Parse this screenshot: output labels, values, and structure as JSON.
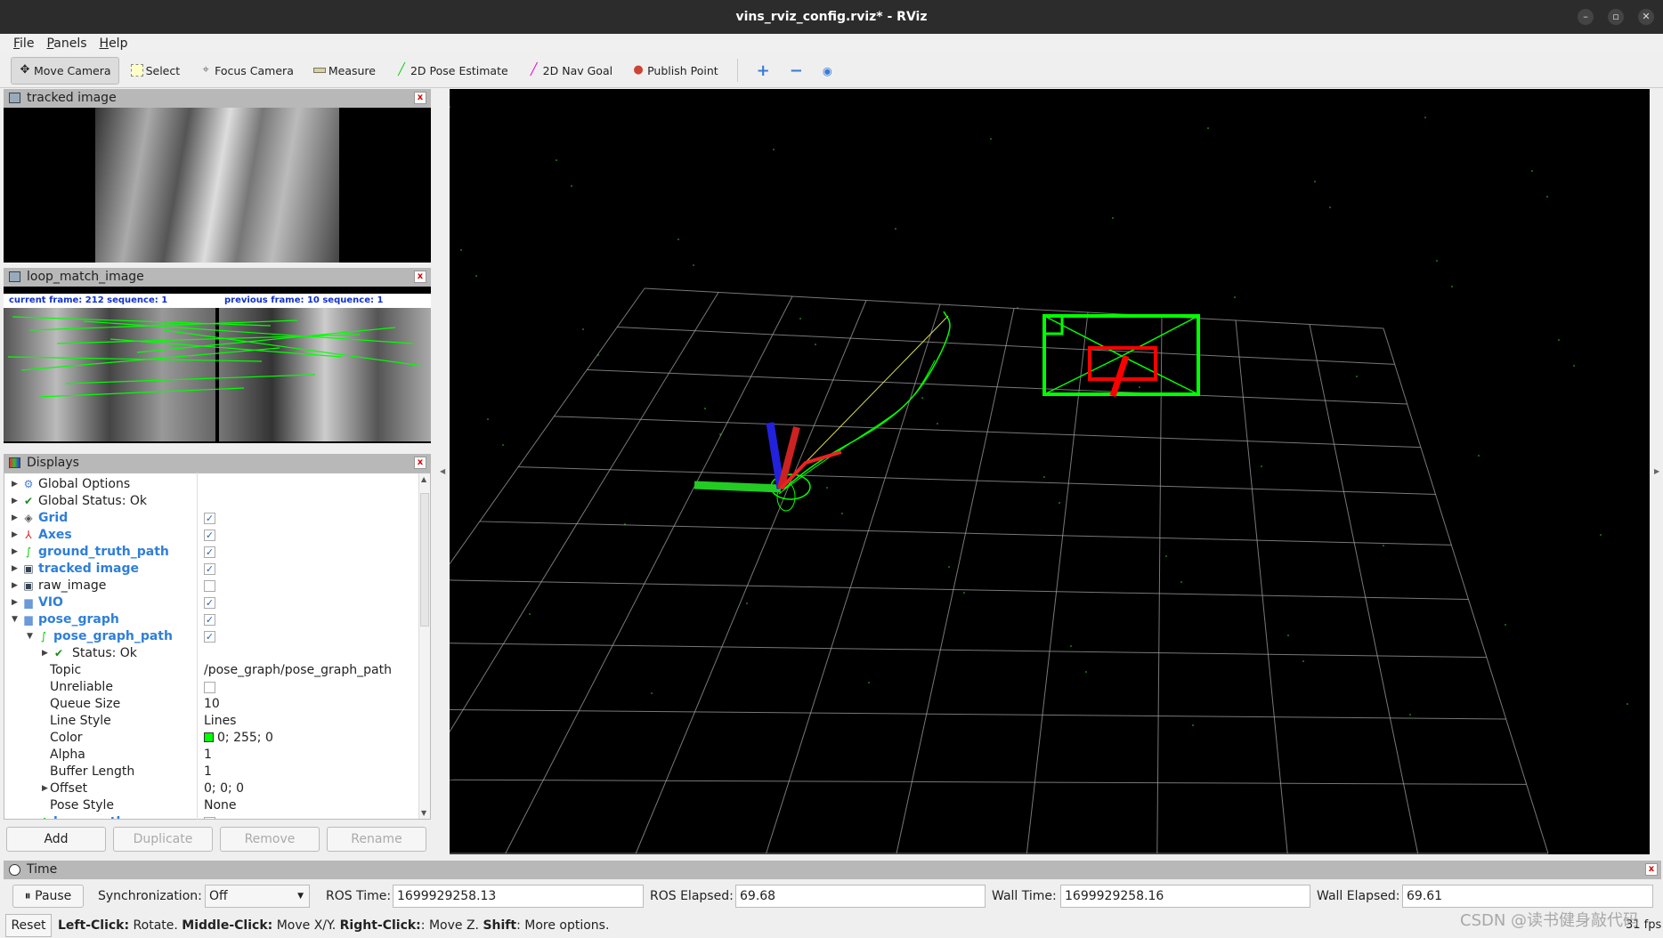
{
  "window": {
    "title": "vins_rviz_config.rviz* - RViz"
  },
  "menu": [
    "File",
    "Panels",
    "Help"
  ],
  "toolbar": {
    "tools": [
      {
        "label": "Move Camera",
        "icon": "move-camera-icon",
        "active": true
      },
      {
        "label": "Select",
        "icon": "select-icon"
      },
      {
        "label": "Focus Camera",
        "icon": "focus-camera-icon"
      },
      {
        "label": "Measure",
        "icon": "measure-icon"
      },
      {
        "label": "2D Pose Estimate",
        "icon": "pose-estimate-icon"
      },
      {
        "label": "2D Nav Goal",
        "icon": "nav-goal-icon"
      },
      {
        "label": "Publish Point",
        "icon": "publish-point-icon"
      }
    ]
  },
  "panels": {
    "tracked": {
      "title": "tracked image"
    },
    "loop": {
      "title": "loop_match_image",
      "current": "current frame: 212   sequence: 1",
      "previous": "previous frame: 10   sequence: 1"
    },
    "displays": {
      "title": "Displays"
    }
  },
  "tree": [
    {
      "label": "Global Options",
      "icon": "gear-icon",
      "indent": 0,
      "arrow": "right"
    },
    {
      "label": "Global Status: Ok",
      "icon": "check-icon",
      "indent": 0,
      "arrow": "right"
    },
    {
      "label": "Grid",
      "icon": "grid-icon",
      "indent": 0,
      "arrow": "right",
      "blue": true,
      "checked": true
    },
    {
      "label": "Axes",
      "icon": "axes-icon",
      "indent": 0,
      "arrow": "right",
      "blue": true,
      "checked": true
    },
    {
      "label": "ground_truth_path",
      "icon": "path-icon",
      "indent": 0,
      "arrow": "right",
      "blue": true,
      "checked": true
    },
    {
      "label": "tracked image",
      "icon": "image-icon",
      "indent": 0,
      "arrow": "right",
      "blue": true,
      "checked": true
    },
    {
      "label": "raw_image",
      "icon": "image-icon",
      "indent": 0,
      "arrow": "right",
      "checked": false
    },
    {
      "label": "VIO",
      "icon": "folder-icon",
      "indent": 0,
      "arrow": "right",
      "blue": true,
      "checked": true
    },
    {
      "label": "pose_graph",
      "icon": "folder-icon",
      "indent": 0,
      "arrow": "down",
      "blue": true,
      "checked": true
    },
    {
      "label": "pose_graph_path",
      "icon": "path-icon",
      "indent": 1,
      "arrow": "down",
      "blue": true,
      "checked": true
    },
    {
      "label": "Status: Ok",
      "icon": "check-icon",
      "indent": 2,
      "arrow": "right"
    },
    {
      "label": "Topic",
      "indent": 2,
      "value": "/pose_graph/pose_graph_path"
    },
    {
      "label": "Unreliable",
      "indent": 2,
      "checked": false
    },
    {
      "label": "Queue Size",
      "indent": 2,
      "value": "10"
    },
    {
      "label": "Line Style",
      "indent": 2,
      "value": "Lines"
    },
    {
      "label": "Color",
      "indent": 2,
      "value": "0; 255; 0",
      "swatch": "#00ff00"
    },
    {
      "label": "Alpha",
      "indent": 2,
      "value": "1"
    },
    {
      "label": "Buffer Length",
      "indent": 2,
      "value": "1"
    },
    {
      "label": "Offset",
      "indent": 2,
      "arrow": "right",
      "value": "0; 0; 0"
    },
    {
      "label": "Pose Style",
      "indent": 2,
      "value": "None"
    },
    {
      "label": "base_path",
      "icon": "path-icon",
      "indent": 1,
      "arrow": "right",
      "blue": true,
      "checked": true
    }
  ],
  "buttons": {
    "add": "Add",
    "duplicate": "Duplicate",
    "remove": "Remove",
    "rename": "Rename"
  },
  "time": {
    "title": "Time",
    "pause": "Pause",
    "sync_label": "Synchronization:",
    "sync_value": "Off",
    "ros_time_label": "ROS Time:",
    "ros_time": "1699929258.13",
    "ros_elapsed_label": "ROS Elapsed:",
    "ros_elapsed": "69.68",
    "wall_time_label": "Wall Time:",
    "wall_time": "1699929258.16",
    "wall_elapsed_label": "Wall Elapsed:",
    "wall_elapsed": "69.61"
  },
  "status": {
    "reset": "Reset",
    "k1": "Left-Click:",
    "t1": " Rotate. ",
    "k2": "Middle-Click:",
    "t2": " Move X/Y. ",
    "k3": "Right-Click:",
    "t3": ": Move Z. ",
    "k4": "Shift",
    "t4": ": More options.",
    "fps": "31 fps"
  },
  "watermark": "CSDN @读书健身敲代码",
  "colors": {
    "path": "#00ff00",
    "camera_frame": "#00ff00",
    "loop": "#ff0000",
    "grid": "#a0a0a0"
  }
}
